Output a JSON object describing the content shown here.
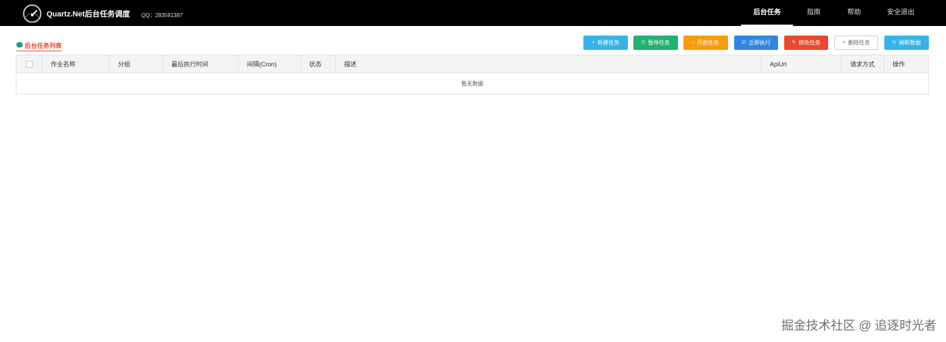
{
  "header": {
    "brand": "Quartz.Net后台任务调度",
    "qq": "QQ：283591387",
    "nav": [
      "后台任务",
      "指南",
      "帮助",
      "安全退出"
    ]
  },
  "section": {
    "title": "后台任务列表"
  },
  "toolbar": {
    "buttons": [
      {
        "label": "新建任务",
        "icon": "+",
        "color": "#36b4e8"
      },
      {
        "label": "暂停任务",
        "icon": "⏻",
        "color": "#21b26f"
      },
      {
        "label": "开启任务",
        "icon": "›",
        "color": "#f59e0b"
      },
      {
        "label": "立即执行",
        "icon": "☑",
        "color": "#2f86e0"
      },
      {
        "label": "修改任务",
        "icon": "✎",
        "color": "#e8492d"
      },
      {
        "label": "删除任务",
        "icon": "×",
        "color": "#ffffff"
      },
      {
        "label": "刷新数据",
        "icon": "↻",
        "color": "#36b4e8"
      }
    ]
  },
  "table": {
    "columns": [
      "作业名称",
      "分组",
      "最后执行时间",
      "间隔(Cron)",
      "状态",
      "描述",
      "ApiUrl",
      "请求方式",
      "操作"
    ],
    "empty_text": "暂无数据"
  },
  "watermark": "掘金技术社区 @ 追逐时光者"
}
